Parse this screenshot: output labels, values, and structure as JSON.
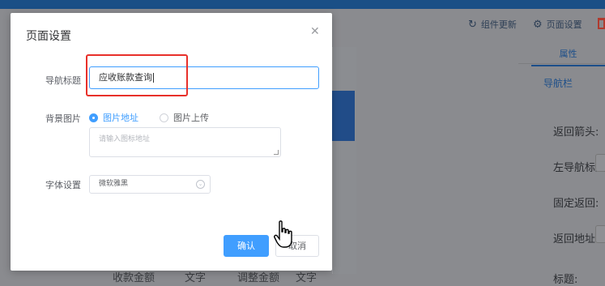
{
  "toolbar": {
    "component_update_label": "组件更新",
    "page_settings_label": "页面设置"
  },
  "right_panel": {
    "tab_label": "属性",
    "section_label": "导航栏",
    "field_labels": [
      "返回箭头:",
      "左导航标题",
      "固定返回:",
      "返回地址:",
      "标题:"
    ]
  },
  "background_table": {
    "items": [
      "收款金额",
      "文字",
      "调整金额",
      "文字"
    ]
  },
  "dialog": {
    "title": "页面设置",
    "nav_title": {
      "label": "导航标题",
      "value": "应收账款查询"
    },
    "background_image": {
      "label": "背景图片",
      "options": [
        "图片地址",
        "图片上传"
      ],
      "selected": "图片地址",
      "textarea_placeholder": "请输入图标地址"
    },
    "font": {
      "label": "字体设置",
      "value": "微软雅黑"
    },
    "buttons": {
      "confirm": "确认",
      "cancel": "取消"
    }
  },
  "colors": {
    "primary": "#409eff",
    "highlight_box": "#e8302a",
    "topbar": "#1a4f86"
  }
}
